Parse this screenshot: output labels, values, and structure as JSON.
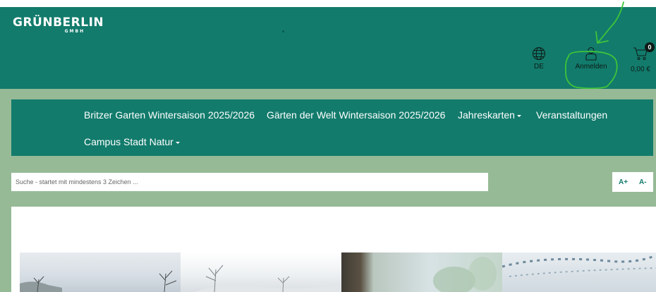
{
  "header": {
    "logo_main": "GRÜNBERLIN",
    "logo_sub": "GMBH",
    "language_label": "DE",
    "login_label": "Anmelden",
    "cart_count": "0",
    "cart_total": "0,00 €"
  },
  "nav": {
    "items": [
      {
        "label": "Britzer Garten Wintersaison 2025/2026"
      },
      {
        "label": "Gärten der Welt Wintersaison 2025/2026"
      },
      {
        "label": "Jahreskarten"
      },
      {
        "label": "Veranstaltungen"
      },
      {
        "label": "Campus Stadt Natur"
      }
    ]
  },
  "search": {
    "placeholder": "Suche - startet mit mindestens 3 Zeichen ..."
  },
  "font_size": {
    "increase_label": "A+",
    "decrease_label": "A-"
  },
  "colors": {
    "header_bg": "#127b6c",
    "page_bg": "#96ba96",
    "accent_text": "#127b6c",
    "annotation": "#3ec43a"
  },
  "icons": [
    "globe-icon",
    "user-icon",
    "cart-icon"
  ]
}
